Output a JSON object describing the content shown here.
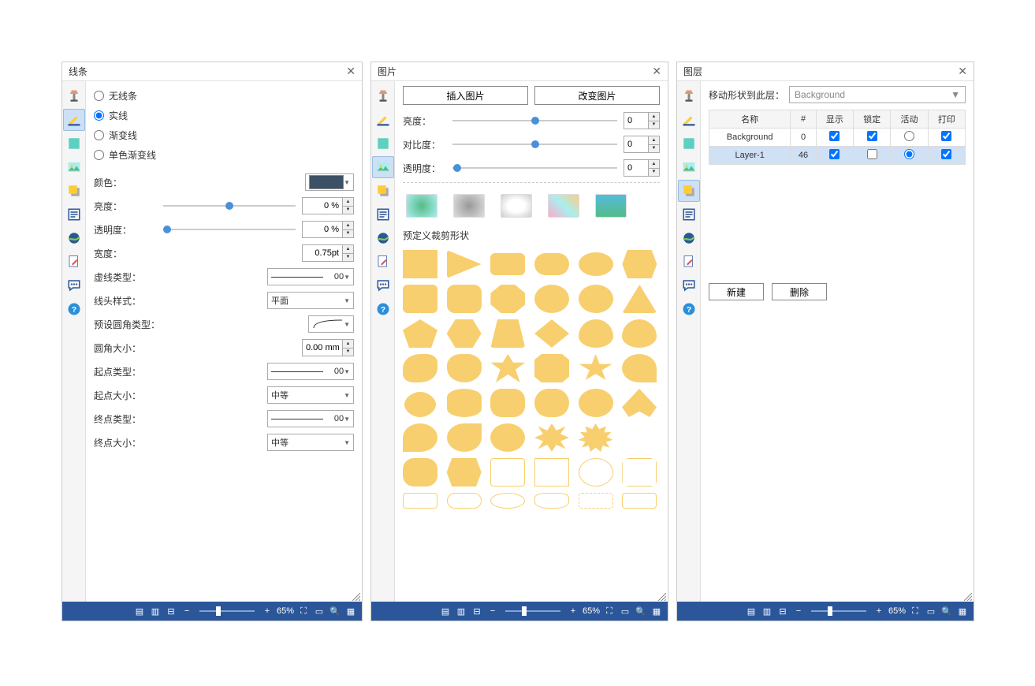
{
  "panel1": {
    "title": "线条",
    "radio_none": "无线条",
    "radio_solid": "实线",
    "radio_gradient": "渐变线",
    "radio_mono": "单色渐变线",
    "color_label": "颜色：",
    "brightness_label": "亮度：",
    "brightness_value": "0 %",
    "opacity_label": "透明度：",
    "opacity_value": "0 %",
    "width_label": "宽度：",
    "width_value": "0.75pt",
    "dash_label": "虚线类型：",
    "dash_value": "00",
    "cap_label": "线头样式：",
    "cap_value": "平面",
    "corner_label": "预设圆角类型：",
    "radius_label": "圆角大小：",
    "radius_value": "0.00 mm",
    "start_type_label": "起点类型：",
    "start_type_value": "00",
    "start_size_label": "起点大小：",
    "start_size_value": "中等",
    "end_type_label": "终点类型：",
    "end_type_value": "00",
    "end_size_label": "终点大小：",
    "end_size_value": "中等"
  },
  "panel2": {
    "title": "图片",
    "insert_btn": "插入图片",
    "change_btn": "改变图片",
    "brightness_label": "亮度：",
    "brightness_value": "0",
    "contrast_label": "对比度：",
    "contrast_value": "0",
    "opacity_label": "透明度：",
    "opacity_value": "0",
    "section": "预定义裁剪形状"
  },
  "panel3": {
    "title": "图层",
    "move_label": "移动形状到此层：",
    "move_value": "Background",
    "col_name": "名称",
    "col_count": "#",
    "col_show": "显示",
    "col_lock": "锁定",
    "col_active": "活动",
    "col_print": "打印",
    "rows": [
      {
        "name": "Background",
        "count": "0",
        "show": true,
        "lock": true,
        "active": false,
        "print": true
      },
      {
        "name": "Layer-1",
        "count": "46",
        "show": true,
        "lock": false,
        "active": true,
        "print": true
      }
    ],
    "new_btn": "新建",
    "del_btn": "删除"
  },
  "status": {
    "zoom": "65%"
  }
}
